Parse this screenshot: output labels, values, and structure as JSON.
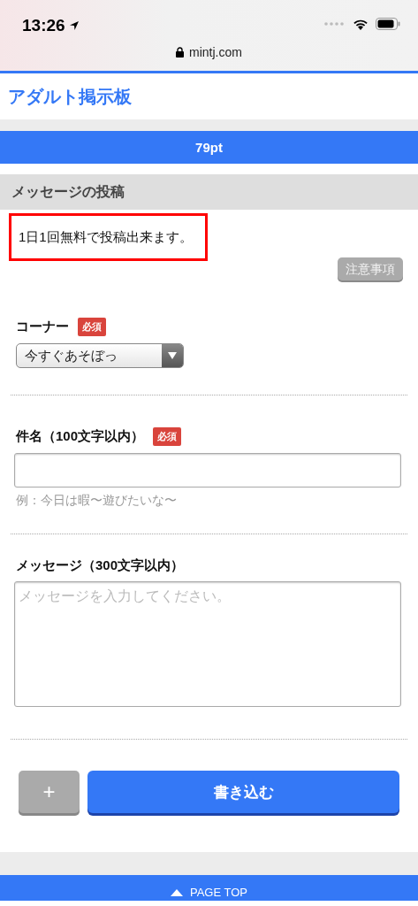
{
  "status_bar": {
    "time": "13:26",
    "url": "mintj.com"
  },
  "header": {
    "title": "アダルト掲示板"
  },
  "points": "79pt",
  "section": {
    "title": "メッセージの投稿"
  },
  "notice": "1日1回無料で投稿出来ます。",
  "notes_button": "注意事項",
  "fields": [
    {
      "kind": "select",
      "label": "コーナー",
      "badge": "必須",
      "value": "今すぐあそぼっ"
    },
    {
      "kind": "text",
      "label": "件名（100文字以内）",
      "badge": "必須",
      "hint": "例：今日は暇〜遊びたいな〜"
    },
    {
      "kind": "textarea",
      "label": "メッセージ（300文字以内）",
      "placeholder": "メッセージを入力してください。"
    }
  ],
  "buttons": {
    "add": "+",
    "submit": "書き込む"
  },
  "footer": {
    "page_top": "PAGE TOP"
  }
}
